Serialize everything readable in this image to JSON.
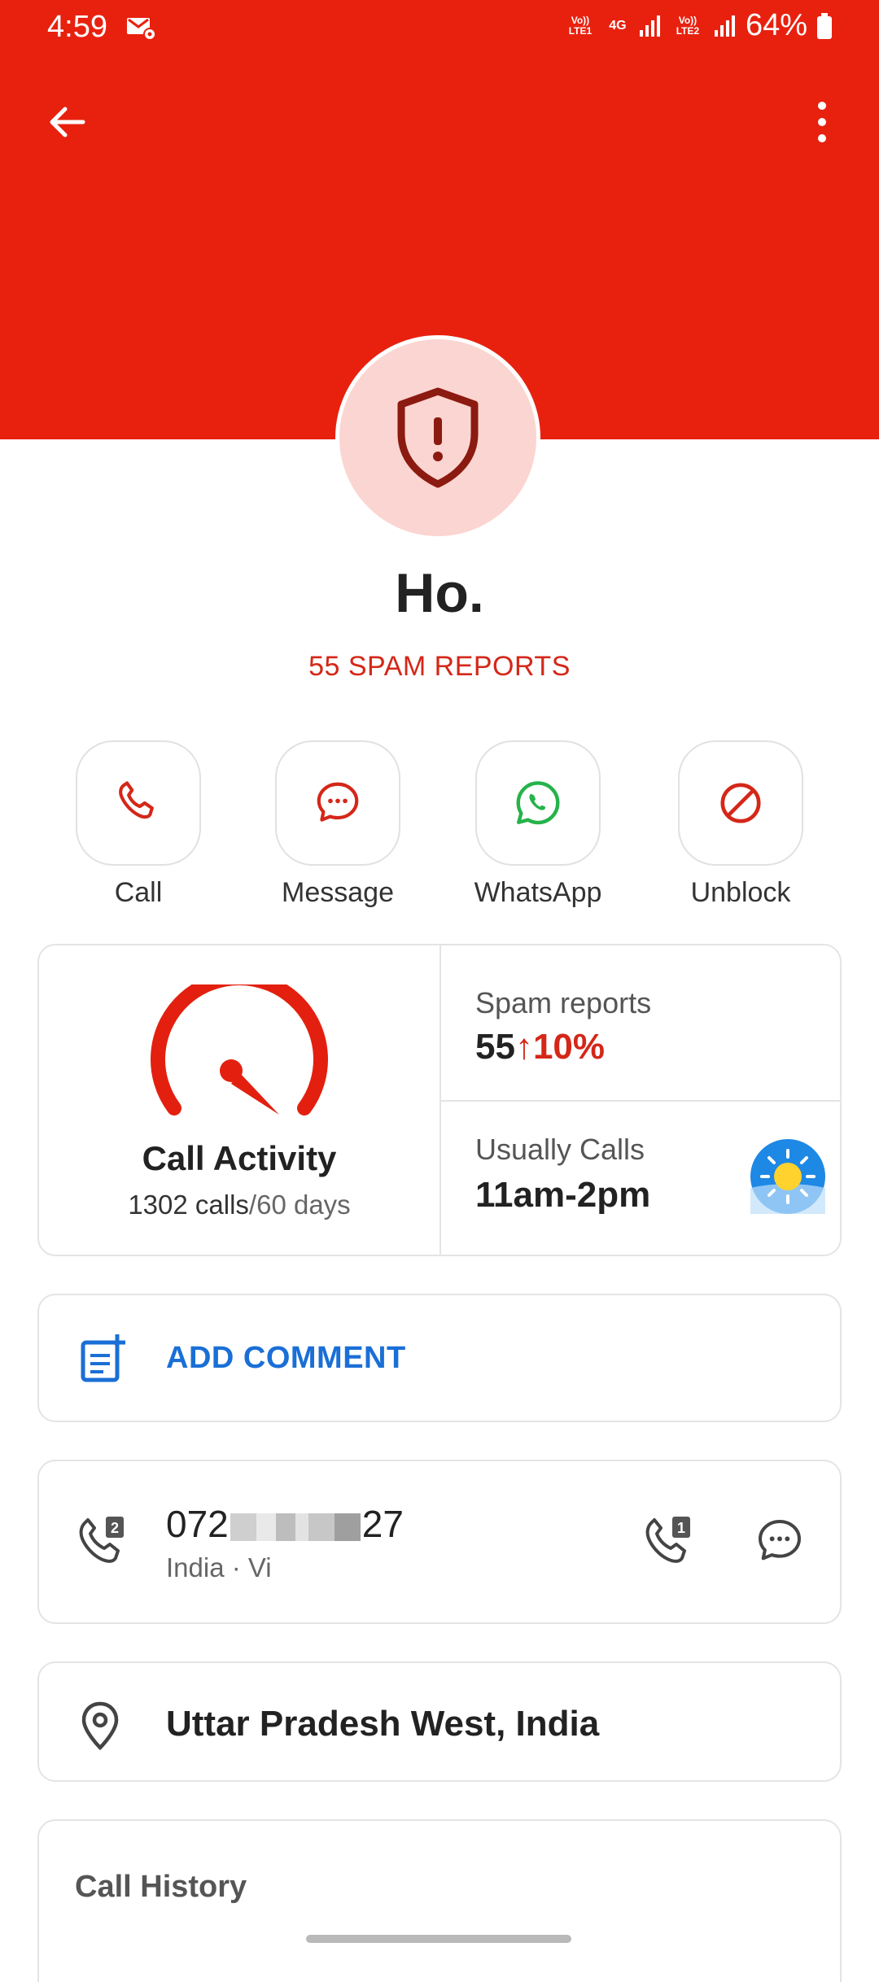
{
  "status_bar": {
    "time": "4:59",
    "sim1_label": "Vo)) LTE1",
    "network_label": "4G",
    "sim2_label": "Vo)) LTE2",
    "battery": "64%"
  },
  "header": {
    "back_icon": "arrow-left-icon",
    "menu_icon": "more-vertical-icon",
    "color": "#e8210f"
  },
  "profile": {
    "name": "Ho.",
    "spam_label": "55 SPAM REPORTS",
    "avatar_icon": "shield-exclamation-icon"
  },
  "actions": [
    {
      "label": "Call",
      "icon": "phone-icon"
    },
    {
      "label": "Message",
      "icon": "chat-bubble-icon"
    },
    {
      "label": "WhatsApp",
      "icon": "whatsapp-icon"
    },
    {
      "label": "Unblock",
      "icon": "block-icon"
    }
  ],
  "stats": {
    "call_activity_title": "Call Activity",
    "call_activity_count": "1302 calls",
    "call_activity_period": "/60 days",
    "spam_reports_label": "Spam reports",
    "spam_reports_value": "55",
    "spam_reports_trend": "10%",
    "usually_calls_label": "Usually Calls",
    "usually_calls_value": "11am-2pm"
  },
  "comment": {
    "label": "ADD COMMENT"
  },
  "number": {
    "prefix": "072",
    "suffix": "27",
    "carrier": "India · Vi",
    "sim_badge_left": "2",
    "sim_badge_right": "1"
  },
  "location": {
    "text": "Uttar Pradesh West, India"
  },
  "history": {
    "title": "Call History"
  }
}
